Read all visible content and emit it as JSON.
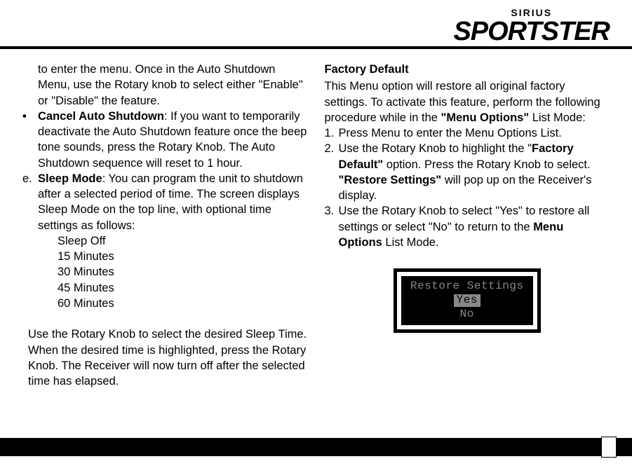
{
  "brand": {
    "small": "SIRIUS",
    "big": "SPORTSTER"
  },
  "left": {
    "intro": "to enter the menu. Once in the Auto Shutdown Menu, use the Rotary knob to select either \"Enable\" or \"Disable\" the feature.",
    "bullet_dot": "•",
    "cancel_bold": "Cancel Auto Shutdown",
    "cancel_rest": ": If you want to temporarily deactivate the Auto Shutdown feature once the beep tone sounds, press the Rotary Knob. The Auto Shutdown sequence will reset to 1 hour.",
    "letter_e": "e.",
    "sleep_bold": "Sleep Mode",
    "sleep_rest": ": You can program the unit to shutdown after a selected period of time. The screen displays Sleep Mode on the top line, with optional time settings as follows:",
    "sleep_options": [
      "Sleep Off",
      "15 Minutes",
      "30 Minutes",
      "45 Minutes",
      "60 Minutes"
    ],
    "trailing": "Use the Rotary Knob to select the desired Sleep Time. When the desired time is highlighted, press the Rotary Knob. The Receiver will now turn off after the selected time has elapsed."
  },
  "right": {
    "heading": "Factory Default",
    "intro_a": "This Menu option will restore all original factory settings. To activate this feature, perform the following procedure while in the ",
    "intro_bold": "\"Menu Options\"",
    "intro_b": " List Mode:",
    "step1_num": "1.",
    "step1_text": "Press Menu to enter the Menu Options List.",
    "step2_num": "2.",
    "step2_a": "Use the Rotary Knob to highlight the \"",
    "step2_bold1": "Factory Default\"",
    "step2_b": " option. Press the Rotary Knob to select. ",
    "step2_bold2": "\"Restore  Settings\"",
    "step2_c": " will pop up on the Receiver's display.",
    "step3_num": "3.",
    "step3_a": "Use the Rotary Knob to select \"Yes\" to restore all settings or select \"No\" to return to the ",
    "step3_bold": "Menu Options",
    "step3_b": " List Mode.",
    "screen": {
      "title": "Restore Settings",
      "yes": "Yes",
      "no": "No"
    }
  }
}
